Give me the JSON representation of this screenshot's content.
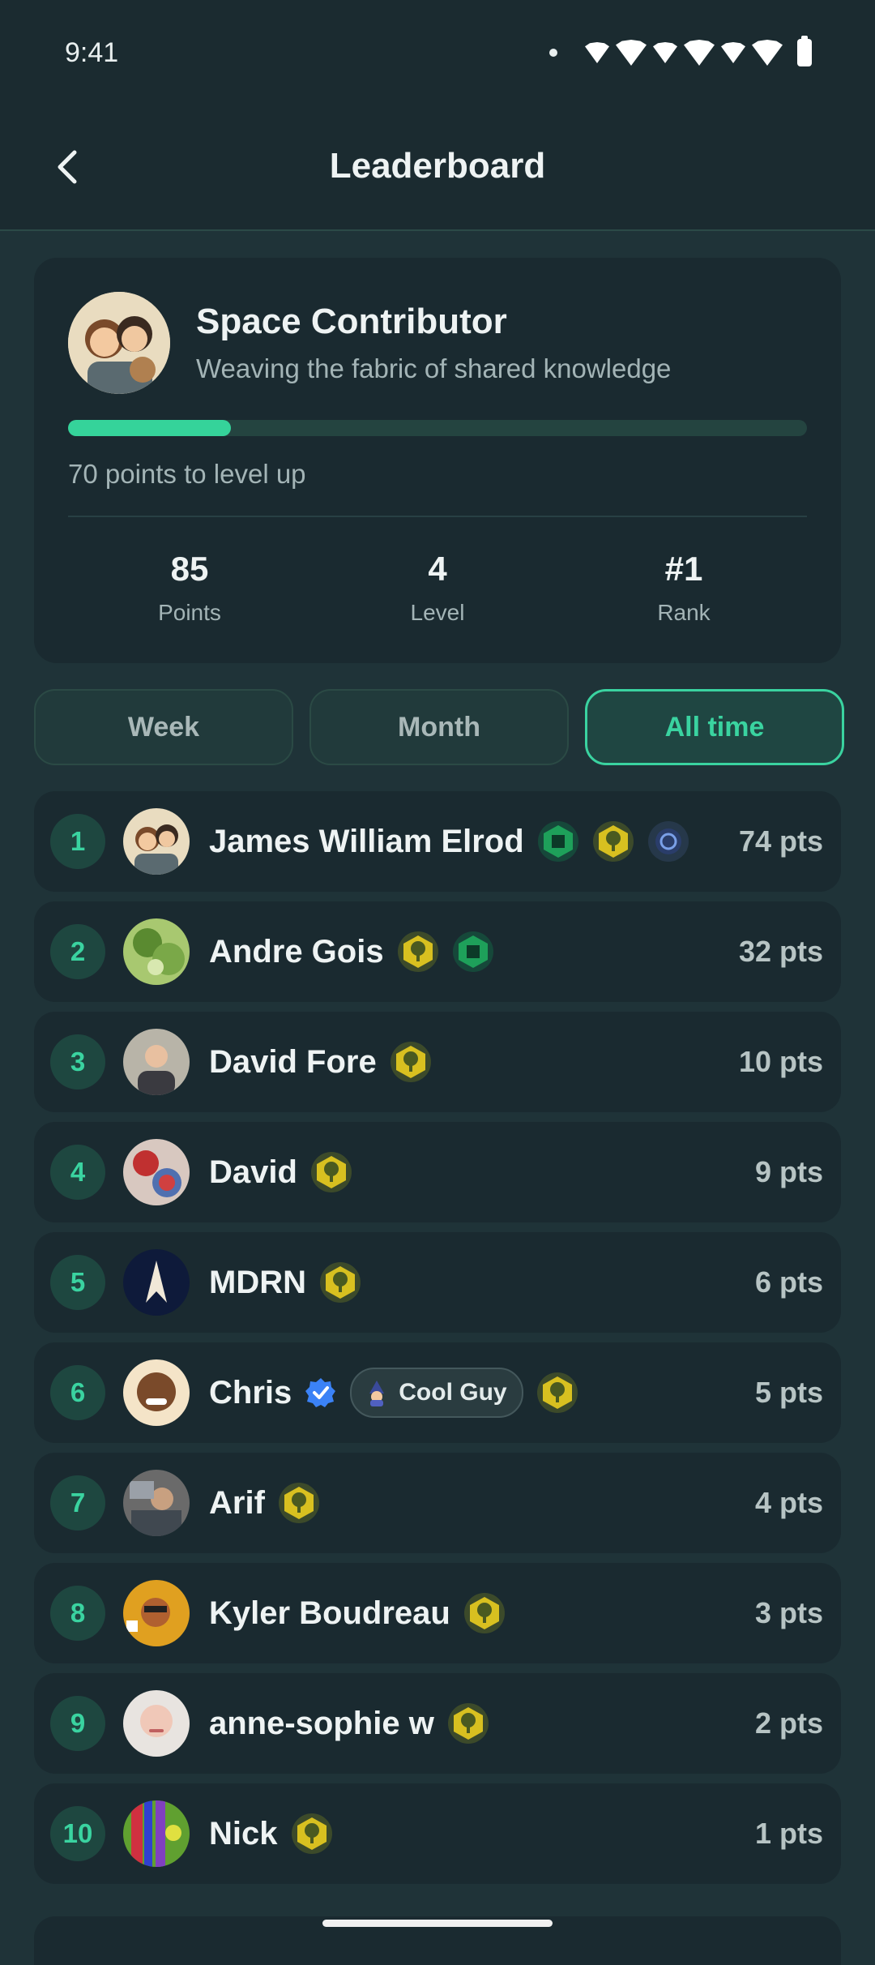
{
  "status_bar": {
    "time": "9:41"
  },
  "header": {
    "title": "Leaderboard"
  },
  "profile": {
    "name": "Space Contributor",
    "subtitle": "Weaving the fabric of shared knowledge",
    "progress": 0.22,
    "levelup_text": "70 points to level up",
    "stats": [
      {
        "value": "85",
        "label": "Points"
      },
      {
        "value": "4",
        "label": "Level"
      },
      {
        "value": "#1",
        "label": "Rank"
      }
    ]
  },
  "tabs": [
    {
      "label": "Week"
    },
    {
      "label": "Month"
    },
    {
      "label": "All time"
    }
  ],
  "selected_tab": "All time",
  "colors": {
    "accent": "#3ad3a0",
    "background": "#1f3338",
    "card": "#1a2a30"
  },
  "leaderboard": [
    {
      "rank": "1",
      "name": "James William Elrod",
      "points": "74 pts",
      "badges": [
        "green-chip-badge-icon",
        "tree-badge-icon",
        "blue-orbit-badge-icon"
      ]
    },
    {
      "rank": "2",
      "name": "Andre Gois",
      "points": "32 pts",
      "badges": [
        "tree-badge-icon",
        "green-chip-badge-icon"
      ]
    },
    {
      "rank": "3",
      "name": "David Fore",
      "points": "10 pts",
      "badges": [
        "tree-badge-icon"
      ]
    },
    {
      "rank": "4",
      "name": "David",
      "points": "9 pts",
      "badges": [
        "tree-badge-icon"
      ]
    },
    {
      "rank": "5",
      "name": "MDRN",
      "points": "6 pts",
      "badges": [
        "tree-badge-icon"
      ]
    },
    {
      "rank": "6",
      "name": "Chris",
      "points": "5 pts",
      "verified": true,
      "tag": "Cool Guy",
      "badges": [
        "tree-badge-icon"
      ]
    },
    {
      "rank": "7",
      "name": "Arif",
      "points": "4 pts",
      "badges": [
        "tree-badge-icon"
      ]
    },
    {
      "rank": "8",
      "name": "Kyler Boudreau",
      "points": "3 pts",
      "badges": [
        "tree-badge-icon"
      ]
    },
    {
      "rank": "9",
      "name": "anne-sophie w",
      "points": "2 pts",
      "badges": [
        "tree-badge-icon"
      ]
    },
    {
      "rank": "10",
      "name": "Nick",
      "points": "1 pts",
      "badges": [
        "tree-badge-icon"
      ]
    }
  ]
}
